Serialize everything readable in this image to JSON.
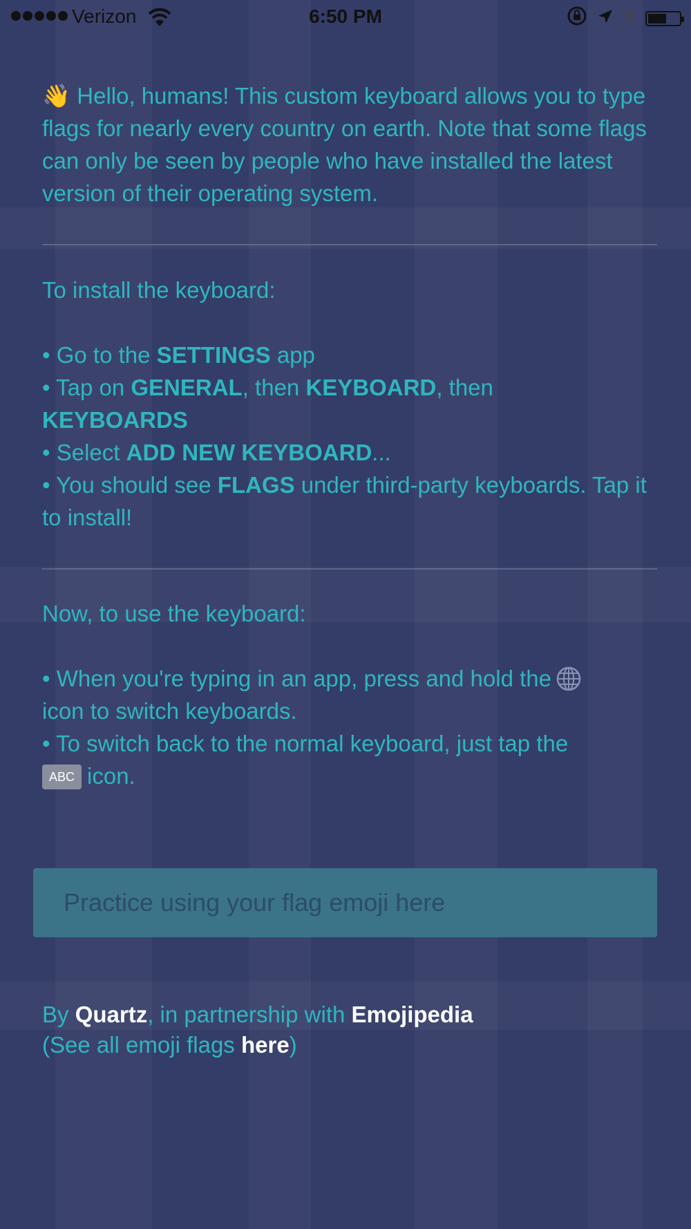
{
  "status_bar": {
    "carrier": "Verizon",
    "time": "6:50 PM",
    "battery_level": 0.6
  },
  "intro": {
    "emoji": "👋",
    "text": "Hello, humans! This custom keyboard allows you to type flags for nearly every country on earth. Note that some flags can only be seen by people who have installed the latest version of their operating system."
  },
  "install": {
    "heading": "To install the keyboard:",
    "step1": {
      "pre": "• Go to the ",
      "b1": "SETTINGS",
      "post": " app"
    },
    "step2": {
      "pre": "• Tap on ",
      "b1": "GENERAL",
      "mid": ", then ",
      "b2": "KEYBOARD",
      "mid2": ", then ",
      "b3": "KEYBOARDS"
    },
    "step3": {
      "pre": "• Select ",
      "b1": "ADD NEW KEYBOARD",
      "post": "..."
    },
    "step4": {
      "pre": "• You should see ",
      "b1": "FLAGS",
      "post": " under third-party keyboards. Tap it to install!"
    }
  },
  "use": {
    "heading": "Now, to use the keyboard:",
    "step1": {
      "text": "• When you're typing in an app, press and hold the",
      "after": " icon to switch keyboards."
    },
    "step2": {
      "text": "• To switch back to the normal keyboard, just tap the",
      "key_label": "ABC",
      "after": "icon."
    }
  },
  "practice_input": {
    "placeholder": "Practice using your flag emoji here",
    "value": ""
  },
  "footer": {
    "by": "By ",
    "quartz": "Quartz",
    "partnership": ", in partnership with ",
    "emojipedia": "Emojipedia",
    "see_all_pre": "(See all emoji flags ",
    "here": "here",
    "see_all_post": ")"
  },
  "colors": {
    "background": "#343d67",
    "text_teal": "#2fb6bf",
    "input_bg": "#3b7489",
    "link": "#ffffff"
  }
}
